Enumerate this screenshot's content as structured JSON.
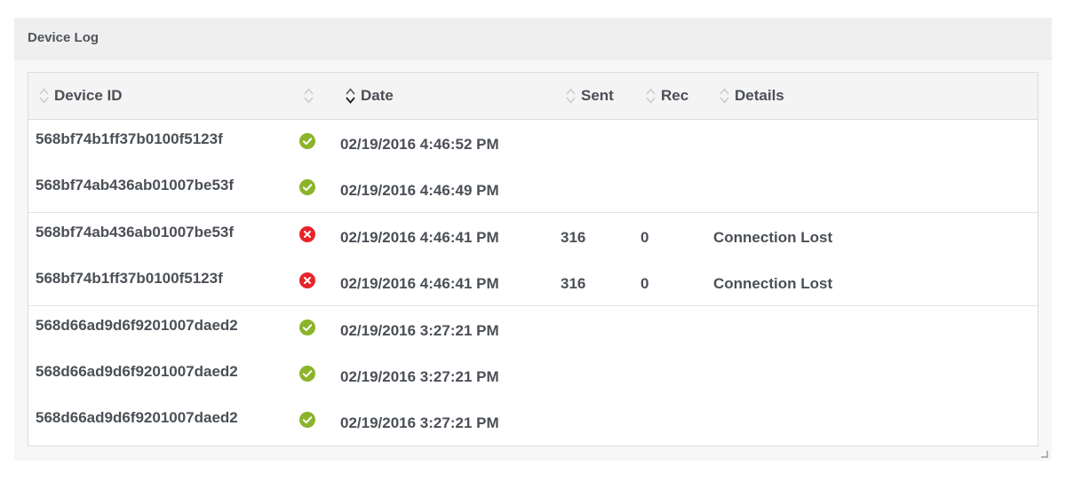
{
  "panel": {
    "title": "Device Log"
  },
  "table": {
    "columns": {
      "device_id": "Device ID",
      "status": "",
      "date": "Date",
      "sent": "Sent",
      "rec": "Rec",
      "details": "Details"
    },
    "active_sort": {
      "column": "date",
      "direction": "descending"
    },
    "rows": [
      {
        "device_id": "568bf74b1ff37b0100f5123f",
        "status": "success",
        "date": "02/19/2016 4:46:52 PM",
        "sent": "",
        "rec": "",
        "details": ""
      },
      {
        "device_id": "568bf74ab436ab01007be53f",
        "status": "success",
        "date": "02/19/2016 4:46:49 PM",
        "sent": "",
        "rec": "",
        "details": ""
      },
      {
        "device_id": "568bf74ab436ab01007be53f",
        "status": "error",
        "date": "02/19/2016 4:46:41 PM",
        "sent": "316",
        "rec": "0",
        "details": "Connection Lost"
      },
      {
        "device_id": "568bf74b1ff37b0100f5123f",
        "status": "error",
        "date": "02/19/2016 4:46:41 PM",
        "sent": "316",
        "rec": "0",
        "details": "Connection Lost"
      },
      {
        "device_id": "568d66ad9d6f9201007daed2",
        "status": "success",
        "date": "02/19/2016 3:27:21 PM",
        "sent": "",
        "rec": "",
        "details": ""
      },
      {
        "device_id": "568d66ad9d6f9201007daed2",
        "status": "success",
        "date": "02/19/2016 3:27:21 PM",
        "sent": "",
        "rec": "",
        "details": ""
      },
      {
        "device_id": "568d66ad9d6f9201007daed2",
        "status": "success",
        "date": "02/19/2016 3:27:21 PM",
        "sent": "",
        "rec": "",
        "details": ""
      }
    ]
  },
  "icons": {
    "success": "check-circle-icon",
    "error": "x-circle-icon",
    "sort": "sort-updown-icon",
    "resize": "resize-grip-icon"
  },
  "colors": {
    "success": "#8bb42b",
    "error": "#e8232a",
    "header_bg": "#efefef",
    "table_header_bg": "#f4f4f4"
  }
}
